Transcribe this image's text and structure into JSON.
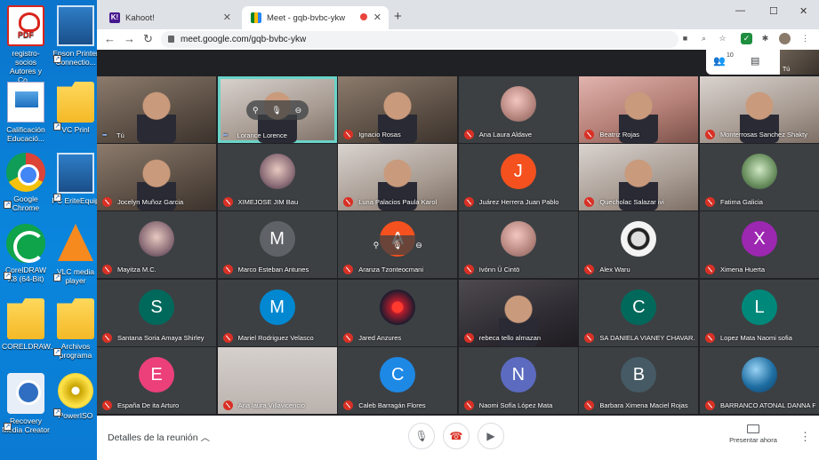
{
  "desktop": {
    "icons": [
      {
        "label": "registro-socios Autores y Co...",
        "kind": "pdf",
        "glyph": "PDF"
      },
      {
        "label": "Epson Printer Connectio...",
        "kind": "app"
      },
      {
        "label": "Calificación Educació...",
        "kind": "doc"
      },
      {
        "label": "VC Prinl",
        "kind": "folder"
      },
      {
        "label": "Google Chrome",
        "kind": "chrome"
      },
      {
        "label": "PC EriteEquip",
        "kind": "pc"
      },
      {
        "label": "CorelDRAW X8 (64-Bit)",
        "kind": "corel"
      },
      {
        "label": "VLC media player",
        "kind": "vlc"
      },
      {
        "label": "CORELDRAW...",
        "kind": "folder"
      },
      {
        "label": "Archivos programa",
        "kind": "folder"
      },
      {
        "label": "Recovery Media Creator",
        "kind": "recovery"
      },
      {
        "label": "PowerISO",
        "kind": "disc"
      }
    ]
  },
  "browser": {
    "tabs": [
      {
        "title": "Kahoot!",
        "favicon": "K!"
      },
      {
        "title": "Meet - gqb-bvbc-ykw"
      }
    ],
    "url": "meet.google.com/gqb-bvbc-ykw"
  },
  "meet": {
    "participant_count": "10",
    "self_label": "Tú",
    "tiles": [
      {
        "name": "Tú",
        "type": "video",
        "tone": "",
        "state": "self"
      },
      {
        "name": "Lorance Lorence",
        "type": "video",
        "tone": "light",
        "state": "speaking"
      },
      {
        "name": "Ignacio Rosas",
        "type": "video",
        "tone": "",
        "state": "muted"
      },
      {
        "name": "Ana Laura Aldave",
        "type": "avatar",
        "photo": "photo",
        "state": "muted"
      },
      {
        "name": "Beatriz Rojas",
        "type": "video",
        "tone": "pink",
        "state": "muted"
      },
      {
        "name": "Monterrosas Sanchez Shakty",
        "type": "video",
        "tone": "light",
        "state": "muted"
      },
      {
        "name": "Jocelyn Muñoz Garcia",
        "type": "video",
        "tone": "",
        "state": "muted"
      },
      {
        "name": "XIMEJOSE JIM Bau",
        "type": "avatar",
        "photo": "photo5",
        "state": "muted"
      },
      {
        "name": "Luna Palacios Paula Karol",
        "type": "video",
        "tone": "light",
        "state": "muted"
      },
      {
        "name": "Juárez Herrera Juan Pablo",
        "type": "avatar",
        "letter": "J",
        "color": "#f4511e",
        "state": "muted"
      },
      {
        "name": "Quecholac Salazar ivi",
        "type": "video",
        "tone": "light",
        "state": "muted"
      },
      {
        "name": "Fatima Galicia",
        "type": "avatar",
        "photo": "photo6",
        "state": "muted"
      },
      {
        "name": "Mayitza M.C.",
        "type": "avatar",
        "photo": "photo5",
        "state": "muted"
      },
      {
        "name": "Marco Esteban Antunes",
        "type": "avatar",
        "letter": "M",
        "color": "#5f6368",
        "state": "muted"
      },
      {
        "name": "Aranza Tzonteocmani",
        "type": "avatar",
        "letter": "A",
        "color": "#f4511e",
        "state": "muted"
      },
      {
        "name": "Ivónn Ü Cintö",
        "type": "avatar",
        "photo": "photo",
        "state": "muted"
      },
      {
        "name": "Alex Waru",
        "type": "avatar",
        "photo": "photo2",
        "state": "muted"
      },
      {
        "name": "Ximena Huerta",
        "type": "avatar",
        "letter": "X",
        "color": "#9c27b0",
        "state": "muted"
      },
      {
        "name": "Santana Soria Amaya Shirley",
        "type": "avatar",
        "letter": "S",
        "color": "#00695c",
        "state": "muted"
      },
      {
        "name": "Mariel Rodriguez Velasco",
        "type": "avatar",
        "letter": "M",
        "color": "#0288d1",
        "state": "muted"
      },
      {
        "name": "Jared Anzures",
        "type": "avatar",
        "photo": "photo3",
        "state": "muted"
      },
      {
        "name": "rebeca tello almazan",
        "type": "video",
        "tone": "dark",
        "state": "muted"
      },
      {
        "name": "SA DANIELA VIANEY CHAVAR...",
        "type": "avatar",
        "letter": "C",
        "color": "#00695c",
        "state": "muted"
      },
      {
        "name": "Lopez Mata Naomi sofia",
        "type": "avatar",
        "letter": "L",
        "color": "#00897b",
        "state": "muted"
      },
      {
        "name": "España De ita Arturo",
        "type": "avatar",
        "letter": "E",
        "color": "#ec407a",
        "state": "muted"
      },
      {
        "name": "Ana laura Villavicencio",
        "type": "video",
        "tone": "blur",
        "state": "muted"
      },
      {
        "name": "Caleb Barragán Flores",
        "type": "avatar",
        "letter": "C",
        "color": "#1e88e5",
        "state": "muted"
      },
      {
        "name": "Naomi Sofía López Mata",
        "type": "avatar",
        "letter": "N",
        "color": "#5c6bc0",
        "state": "muted"
      },
      {
        "name": "Barbara Ximena Maciel Rojas",
        "type": "avatar",
        "letter": "B",
        "color": "#455a64",
        "state": "muted"
      },
      {
        "name": "BARRANCO ATONAL DANNA P...",
        "type": "avatar",
        "photo": "photo4",
        "state": "muted"
      }
    ],
    "controls": {
      "details_label": "Detalles de la reunión",
      "present_label": "Presentar ahora"
    }
  }
}
